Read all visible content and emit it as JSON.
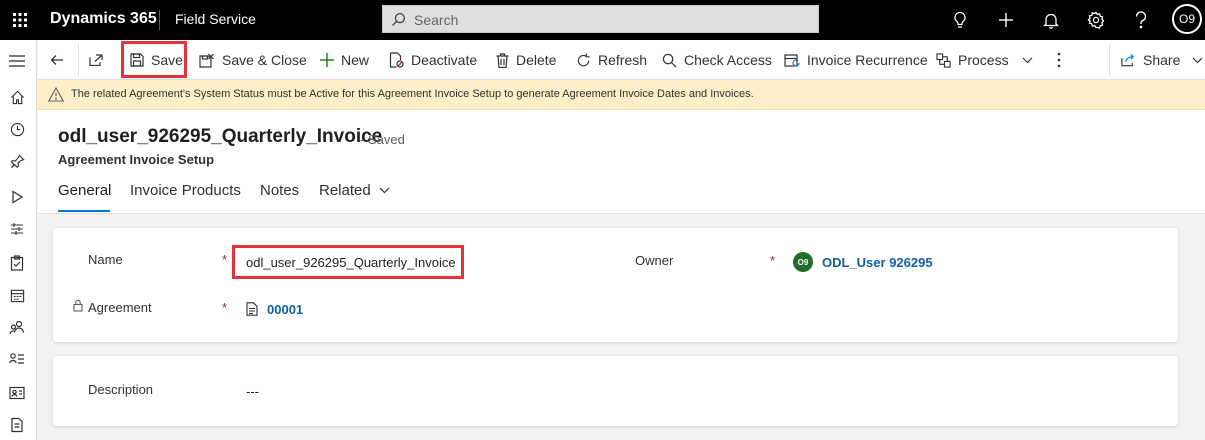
{
  "topbar": {
    "app_title": "Dynamics 365",
    "module_name": "Field Service",
    "search_placeholder": "Search",
    "user_initials": "O9"
  },
  "commands": {
    "save": "Save",
    "save_close": "Save & Close",
    "new": "New",
    "deactivate": "Deactivate",
    "delete": "Delete",
    "refresh": "Refresh",
    "check_access": "Check Access",
    "invoice_recurrence": "Invoice Recurrence",
    "process": "Process",
    "share": "Share"
  },
  "warning": {
    "text": "The related Agreement's System Status must be Active for this Agreement Invoice Setup to generate Agreement Invoice Dates and Invoices."
  },
  "record": {
    "title": "odl_user_926295_Quarterly_Invoice",
    "status": "- Saved",
    "entity": "Agreement Invoice Setup"
  },
  "tabs": [
    "General",
    "Invoice Products",
    "Notes",
    "Related"
  ],
  "form": {
    "name_label": "Name",
    "name_value": "odl_user_926295_Quarterly_Invoice",
    "agreement_label": "Agreement",
    "agreement_value": "00001",
    "owner_label": "Owner",
    "owner_initials": "O9",
    "owner_value": "ODL_User 926295",
    "required_marker": "*",
    "description_label": "Description",
    "description_value": "---"
  },
  "colors": {
    "accent": "#0078d4",
    "highlight_box": "#e3343c",
    "warning_bg": "#fcefc8",
    "link": "#115ea3"
  }
}
